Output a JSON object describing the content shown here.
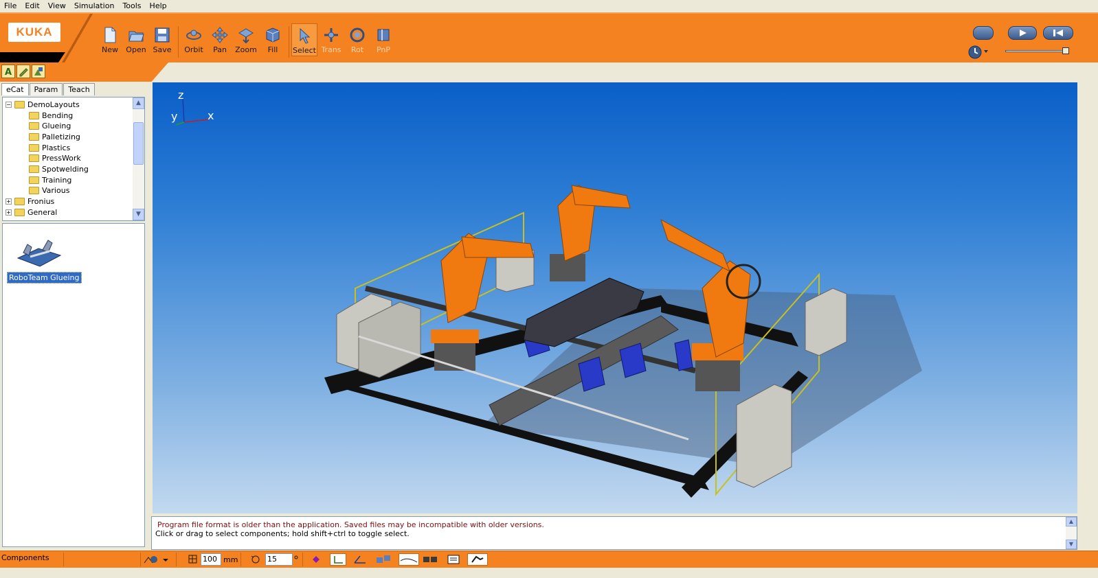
{
  "menu": [
    "File",
    "Edit",
    "View",
    "Simulation",
    "Tools",
    "Help"
  ],
  "brand": {
    "logo_text": "KUKA",
    "accent": "#f58220"
  },
  "toolbar": {
    "new": "New",
    "open": "Open",
    "save": "Save",
    "orbit": "Orbit",
    "pan": "Pan",
    "zoom": "Zoom",
    "fill": "Fill",
    "select": "Select",
    "trans": "Trans",
    "rot": "Rot",
    "pnp": "PnP"
  },
  "tabs": [
    "eCat",
    "Param",
    "Teach"
  ],
  "tree": {
    "root": "DemoLayouts",
    "children": [
      "Bending",
      "Glueing",
      "Palletizing",
      "Plastics",
      "PressWork",
      "Spotwelding",
      "Training",
      "Various"
    ],
    "siblings": [
      "Fronius",
      "General"
    ]
  },
  "components": {
    "selected_item": "RoboTeam Glueing"
  },
  "axes": {
    "z": "z",
    "y": "y",
    "x": "x"
  },
  "messages": {
    "line1": "Program file format is older than the application. Saved files may be incompatible with older versions.",
    "line2": "Click or drag to select components; hold shift+ctrl to toggle select."
  },
  "status": {
    "label": "Components",
    "grid_value": "100",
    "grid_unit": "mm",
    "angle_value": "15"
  }
}
